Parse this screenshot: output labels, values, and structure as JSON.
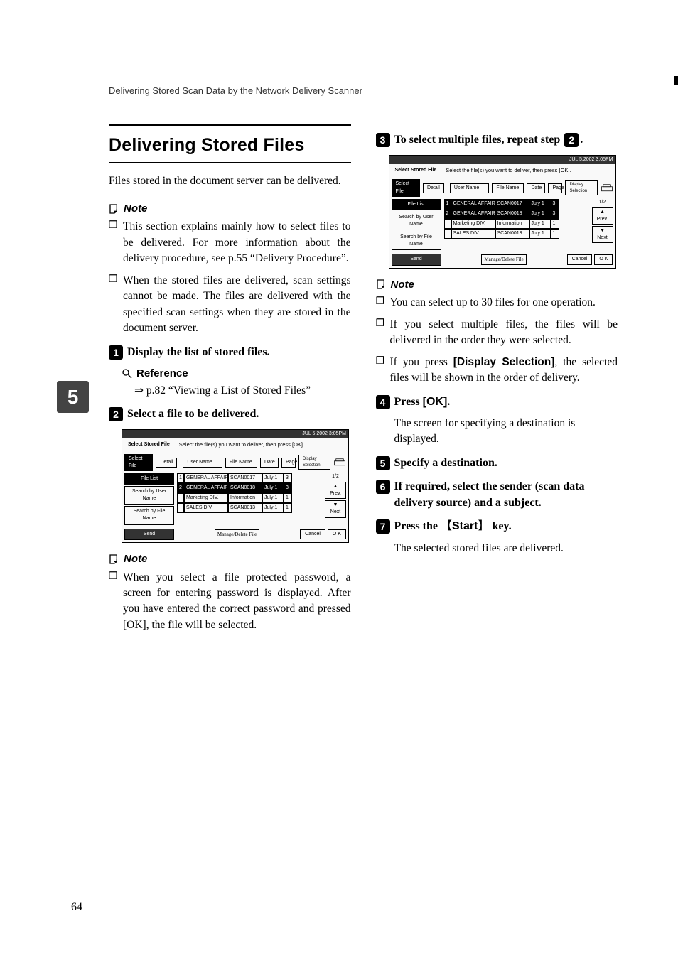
{
  "running_head": "Delivering Stored Scan Data by the Network Delivery Scanner",
  "side_tab": "5",
  "page_number": "64",
  "title": "Delivering Stored Files",
  "intro": "Files stored in the document server can be delivered.",
  "labels": {
    "note": "Note",
    "reference": "Reference"
  },
  "notes_intro": [
    "This section explains mainly how to select files to be delivered. For more information about the delivery procedure, see p.55 “Delivery Procedure”.",
    "When the stored files are delivered, scan settings cannot be made. The files are delivered with the specified scan settings when they are stored in the document server."
  ],
  "step1": {
    "num": "1",
    "text": "Display the list of stored files."
  },
  "reference_text": "p.82 “Viewing a List of Stored Files”",
  "ref_arrow": "⇒",
  "step2": {
    "num": "2",
    "text": "Select a file to be delivered."
  },
  "screenshot_common": {
    "topbar_date": "JUL    5.2002   3:05PM",
    "title_tab": "Select Stored File",
    "instruction": "Select the file(s) you want to deliver, then press [OK].",
    "tabs": {
      "select": "Select File",
      "detail": "Detail"
    },
    "left_buttons": {
      "file_list": "File List",
      "search_user": "Search by User Name",
      "search_file": "Search by File Name",
      "send": "Send"
    },
    "headers": {
      "user": "User Name",
      "file": "File Name",
      "date": "Date",
      "page": "Page",
      "display": "Display Selection"
    },
    "rows": [
      {
        "n": "1",
        "user": "GENERAL AFFAIRS",
        "file": "SCAN0017",
        "date": "July   1",
        "page": "3"
      },
      {
        "n": "2",
        "user": "GENERAL AFFAIRS",
        "file": "SCAN0018",
        "date": "July   1",
        "page": "3"
      },
      {
        "n": "",
        "user": "Marketing DIV.",
        "file": "Information",
        "date": "July   1",
        "page": "1"
      },
      {
        "n": "",
        "user": "SALES DIV.",
        "file": "SCAN0013",
        "date": "July   1",
        "page": "1"
      }
    ],
    "count": "1/2",
    "nav": {
      "prev": "▲ Prev.",
      "next": "▼ Next"
    },
    "manage": "Manage/Delete File",
    "cancel": "Cancel",
    "ok": "O K"
  },
  "notes_step2": [
    "When you select a file protected password, a screen for entering password is displayed. After you have entered the correct password and pressed [OK], the file will be selected."
  ],
  "step3": {
    "num": "3",
    "text_a": "To select multiple files, repeat step ",
    "ref": "2",
    "text_b": "."
  },
  "notes_step3": [
    "You can select up to 30 files for one operation.",
    "If you select multiple files, the files will be delivered in the order they were selected.",
    {
      "prefix": "If you press ",
      "bold": "[Display Selection]",
      "suffix": ", the selected files will be shown in the order of delivery."
    }
  ],
  "step4": {
    "num": "4",
    "text_a": "Press ",
    "bold": "[OK]",
    "text_b": "."
  },
  "step4_body": "The screen for specifying a destination is displayed.",
  "step5": {
    "num": "5",
    "text": "Specify a destination."
  },
  "step6": {
    "num": "6",
    "text": "If required, select the sender (scan data delivery source) and a subject."
  },
  "step7": {
    "num": "7",
    "text_a": "Press the ",
    "key": "Start",
    "text_b": " key."
  },
  "step7_body": "The selected stored files are delivered."
}
